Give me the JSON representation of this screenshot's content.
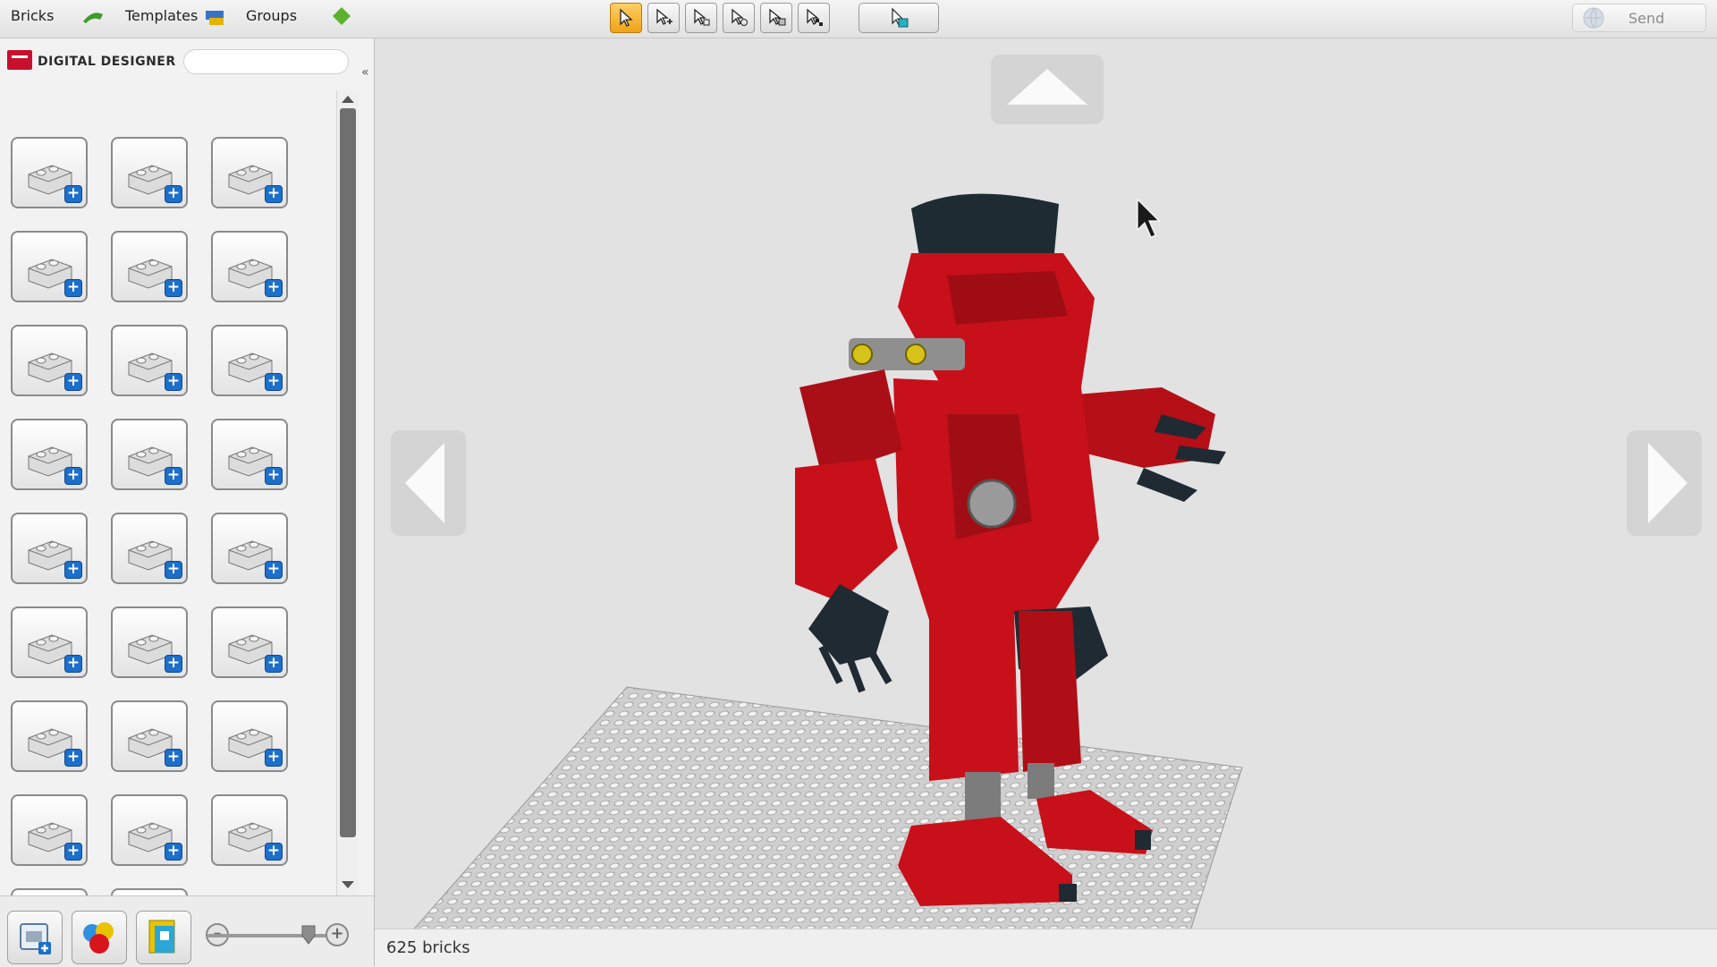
{
  "tabs": {
    "bricks": "Bricks",
    "templates": "Templates",
    "groups": "Groups"
  },
  "logo": {
    "text": "DIGITAL DESIGNER"
  },
  "search": {
    "placeholder": ""
  },
  "toolbar": {
    "tools": [
      {
        "icon": "select-icon",
        "active": true
      },
      {
        "icon": "multi-select-icon",
        "active": false
      },
      {
        "icon": "select-connected-icon",
        "active": false
      },
      {
        "icon": "select-same-color-icon",
        "active": false
      },
      {
        "icon": "select-same-shape-icon",
        "active": false
      },
      {
        "icon": "invert-selection-icon",
        "active": false
      }
    ],
    "camera_icon": "camera-mode-icon"
  },
  "send": {
    "label": "Send"
  },
  "palette": {
    "columns": 3,
    "items": [
      "brick-2x4",
      "brick-round",
      "brick-technic-pin",
      "brick-1x6",
      "slope-brick",
      "wedge-slope",
      "curved-brick",
      "plate-2x2",
      "wedge-plate",
      "plate-with-hole",
      "tile-slope",
      "plate-rounded",
      "door-panel",
      "wheel-tire",
      "bar-handle",
      "minifigure",
      "disc-wheel",
      "engine-part",
      "technic-beam",
      "technic-liftarm",
      "axle-pin",
      "gear-wheel",
      "cylinder",
      "curved-panel",
      "joint-ball",
      "long-slope"
    ]
  },
  "bottom": {
    "modes": [
      "build-mode-icon",
      "paint-mode-icon",
      "instructions-mode-icon"
    ],
    "zoom_level": 0.75
  },
  "viewport": {
    "nav": [
      "camera-up-icon",
      "camera-left-icon",
      "camera-right-icon"
    ]
  },
  "status": {
    "text": "625 bricks"
  },
  "colors": {
    "accent": "#f0a316",
    "brick_red": "#c8101a",
    "plus_blue": "#1c6fcb"
  }
}
